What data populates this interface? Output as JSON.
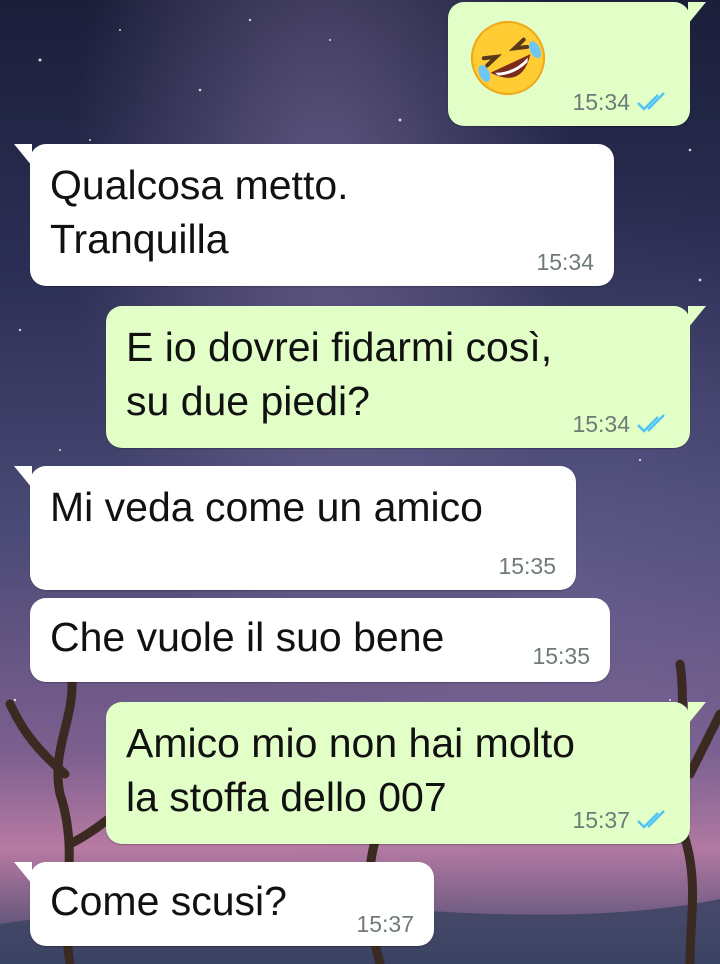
{
  "messages": [
    {
      "side": "out",
      "type": "emoji",
      "emoji_name": "rolling-on-floor-laughing",
      "time": "15:34",
      "read": true
    },
    {
      "side": "in",
      "lines": [
        "Qualcosa metto.",
        "Tranquilla"
      ],
      "time": "15:34"
    },
    {
      "side": "out",
      "lines": [
        "E io dovrei fidarmi così,",
        "su due piedi?"
      ],
      "time": "15:34",
      "read": true
    },
    {
      "side": "in",
      "lines": [
        "Mi veda come un amico"
      ],
      "time": "15:35"
    },
    {
      "side": "in",
      "lines": [
        "Che vuole il suo bene"
      ],
      "time": "15:35"
    },
    {
      "side": "out",
      "lines": [
        "Amico mio non hai molto",
        "la stoffa dello 007"
      ],
      "time": "15:37",
      "read": true
    },
    {
      "side": "in",
      "lines": [
        "Come scusi?"
      ],
      "time": "15:37"
    }
  ],
  "colors": {
    "incoming": "#ffffff",
    "outgoing": "#e1ffc7",
    "read_check": "#4fc3f7",
    "time_text": "#6f7b78"
  }
}
